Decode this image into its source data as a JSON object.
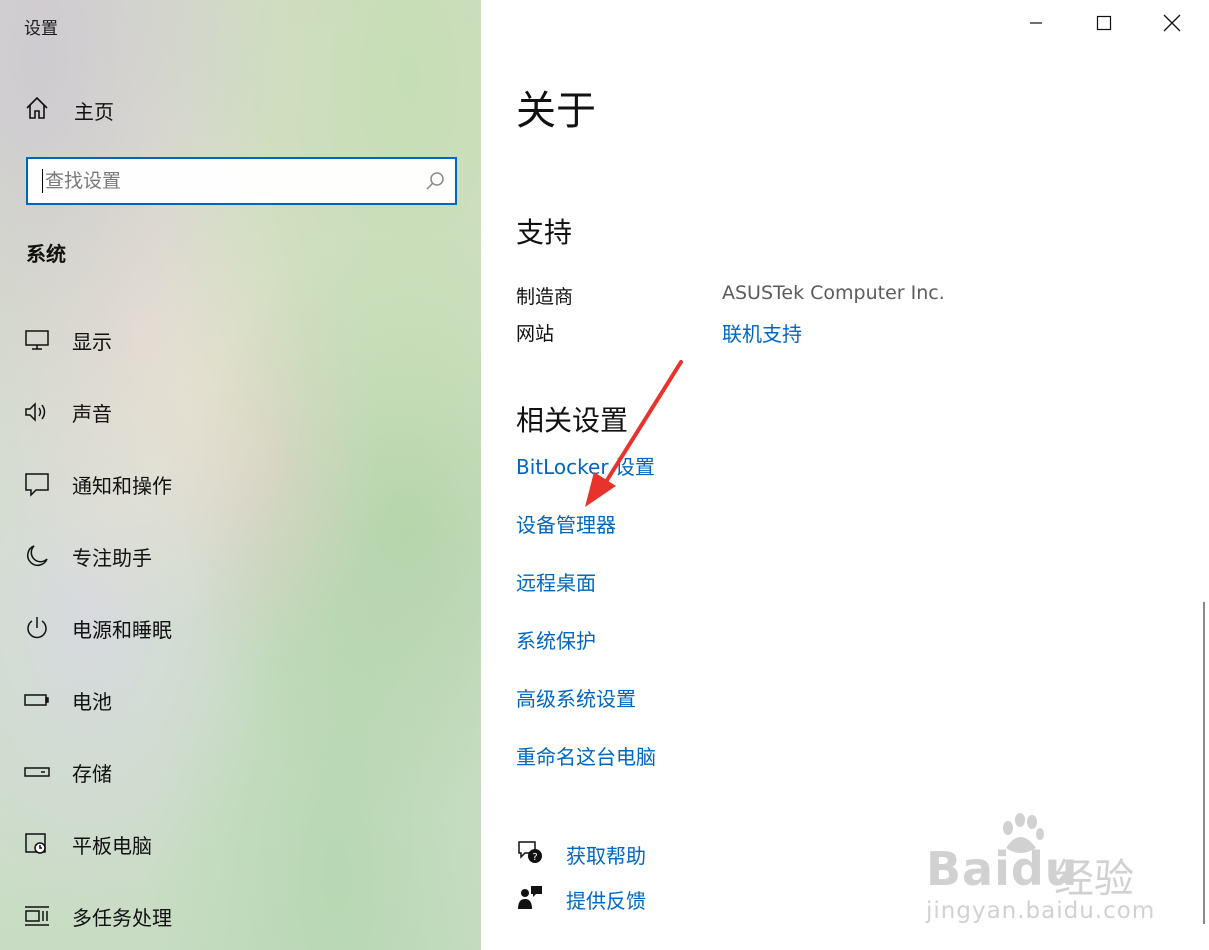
{
  "window": {
    "title": "设置"
  },
  "sidebar": {
    "home_label": "主页",
    "search_placeholder": "查找设置",
    "search_value": "",
    "section_title": "系统",
    "items": [
      {
        "label": "显示",
        "icon": "monitor-icon"
      },
      {
        "label": "声音",
        "icon": "speaker-icon"
      },
      {
        "label": "通知和操作",
        "icon": "notification-icon"
      },
      {
        "label": "专注助手",
        "icon": "moon-icon"
      },
      {
        "label": "电源和睡眠",
        "icon": "power-icon"
      },
      {
        "label": "电池",
        "icon": "battery-icon"
      },
      {
        "label": "存储",
        "icon": "storage-drive-icon"
      },
      {
        "label": "平板电脑",
        "icon": "tablet-icon"
      },
      {
        "label": "多任务处理",
        "icon": "multitasking-icon"
      }
    ]
  },
  "main": {
    "title": "关于",
    "support": {
      "heading": "支持",
      "manufacturer_label": "制造商",
      "manufacturer_value": "ASUSTek Computer Inc.",
      "website_label": "网站",
      "website_link": "联机支持"
    },
    "related": {
      "heading": "相关设置",
      "links": [
        "BitLocker 设置",
        "设备管理器",
        "远程桌面",
        "系统保护",
        "高级系统设置",
        "重命名这台电脑"
      ]
    },
    "help": {
      "get_help": "获取帮助",
      "feedback": "提供反馈"
    }
  },
  "watermark": {
    "logo": "Baidu",
    "suffix": "经验",
    "url": "jingyan.baidu.com"
  },
  "colors": {
    "accent": "#0067c0",
    "annotation_arrow": "#e8322b"
  }
}
